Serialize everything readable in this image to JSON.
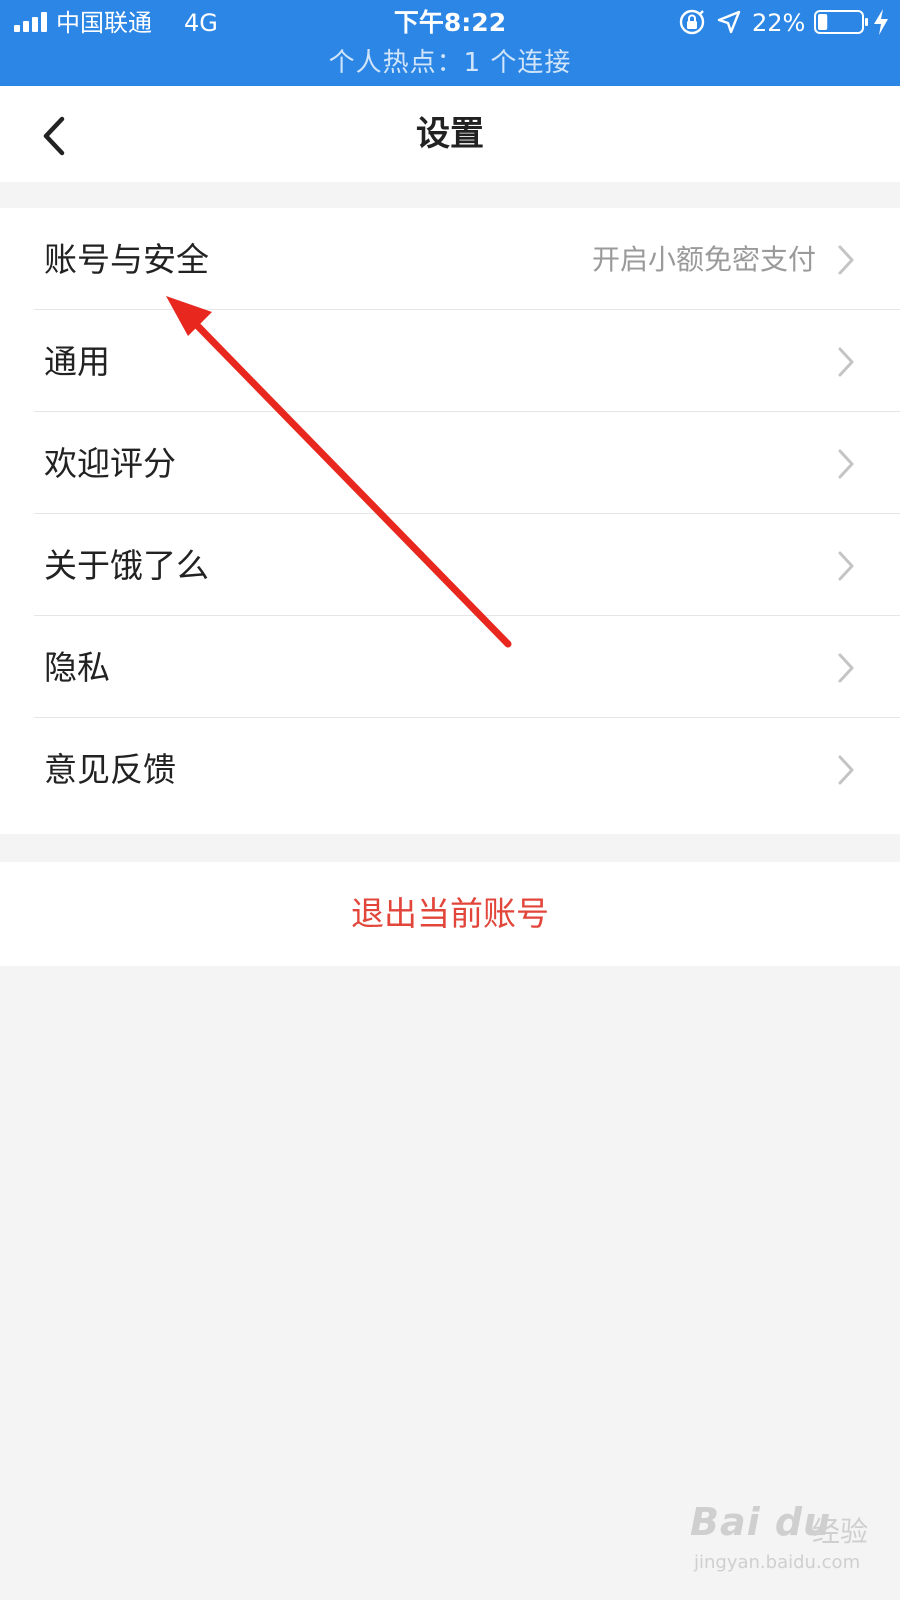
{
  "status_bar": {
    "carrier": "中国联通",
    "network": "4G",
    "time": "下午8:22",
    "battery_percent": "22%",
    "battery_level": 0.22,
    "hotspot": "个人热点：1 个连接",
    "background_color": "#2c86e6"
  },
  "nav": {
    "title": "设置",
    "back_icon": "chevron-left-icon"
  },
  "settings_list": [
    {
      "label": "账号与安全",
      "detail": "开启小额免密支付"
    },
    {
      "label": "通用",
      "detail": ""
    },
    {
      "label": "欢迎评分",
      "detail": ""
    },
    {
      "label": "关于饿了么",
      "detail": ""
    },
    {
      "label": "隐私",
      "detail": ""
    },
    {
      "label": "意见反馈",
      "detail": ""
    }
  ],
  "logout_label": "退出当前账号",
  "colors": {
    "logout_red": "#e2463b",
    "annotation_arrow": "#e8281e",
    "page_background": "#f4f4f4"
  },
  "watermark": {
    "logo": "Bai du",
    "text": "经验",
    "url": "jingyan.baidu.com"
  }
}
